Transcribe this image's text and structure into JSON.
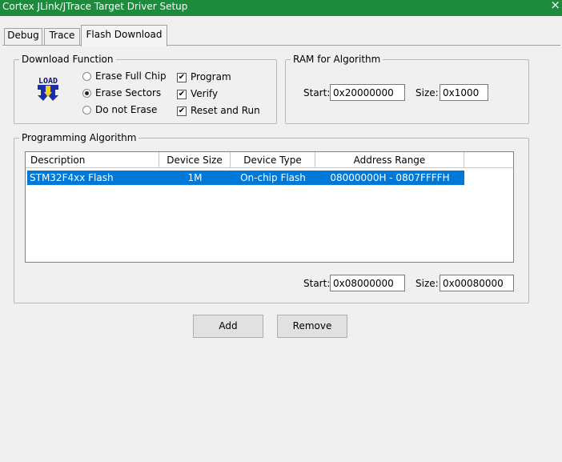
{
  "window": {
    "title": "Cortex JLink/JTrace Target Driver Setup",
    "close_glyph": "×"
  },
  "tabs": [
    {
      "label": "Debug"
    },
    {
      "label": "Trace"
    },
    {
      "label": "Flash Download"
    }
  ],
  "download_function": {
    "title": "Download Function",
    "icon_label": "LOAD",
    "erase_options": [
      {
        "label": "Erase Full Chip",
        "checked": false
      },
      {
        "label": "Erase Sectors",
        "checked": true
      },
      {
        "label": "Do not Erase",
        "checked": false
      }
    ],
    "checks": [
      {
        "label": "Program",
        "checked": true
      },
      {
        "label": "Verify",
        "checked": true
      },
      {
        "label": "Reset and Run",
        "checked": true
      }
    ]
  },
  "ram": {
    "title": "RAM for Algorithm",
    "start_label": "Start:",
    "start_value": "0x20000000",
    "size_label": "Size:",
    "size_value": "0x1000"
  },
  "programming": {
    "title": "Programming Algorithm",
    "columns": [
      "Description",
      "Device Size",
      "Device Type",
      "Address Range"
    ],
    "rows": [
      {
        "description": "STM32F4xx Flash",
        "device_size": "1M",
        "device_type": "On-chip Flash",
        "address_range": "08000000H - 0807FFFFH"
      }
    ],
    "start_label": "Start:",
    "start_value": "0x08000000",
    "size_label": "Size:",
    "size_value": "0x00080000"
  },
  "buttons": {
    "add": "Add",
    "remove": "Remove"
  }
}
